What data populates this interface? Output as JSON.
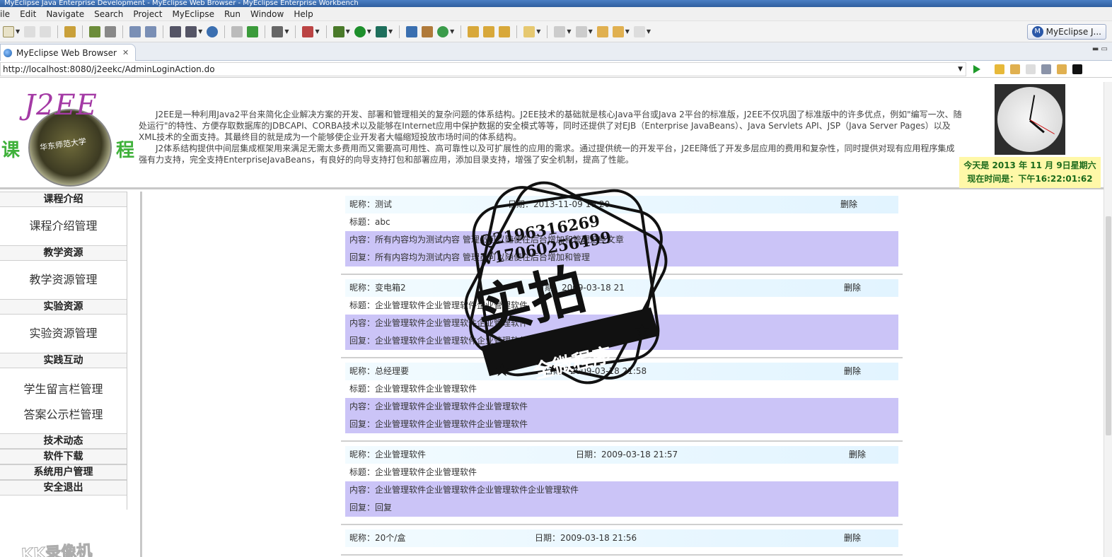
{
  "window": {
    "title": "MyEclipse Java Enterprise Development - MyEclipse Web Browser - MyEclipse Enterprise Workbench"
  },
  "menu": [
    "ile",
    "Edit",
    "Navigate",
    "Search",
    "Project",
    "MyEclipse",
    "Run",
    "Window",
    "Help"
  ],
  "perspective": {
    "label": "MyEclipse J..."
  },
  "tab": {
    "label": "MyEclipse Web Browser",
    "close": "✕"
  },
  "address": {
    "url": "http://localhost:8080/j2eekc/AdminLoginAction.do"
  },
  "header": {
    "logo_text": "J2EE",
    "logo_left": "课",
    "logo_right": "程",
    "seal_text": "华东师范大学",
    "intro_p1": "J2EE是一种利用Java2平台来简化企业解决方案的开发、部署和管理相关的复杂问题的体系结构。J2EE技术的基础就是核心Java平台或Java 2平台的标准版，J2EE不仅巩固了标准版中的许多优点，例如\"编写一次、随处运行\"的特性、方便存取数据库的JDBCAPI、CORBA技术以及能够在Internet应用中保护数据的安全模式等等，同时还提供了对EJB（Enterprise JavaBeans）、Java Servlets API、JSP（Java Server Pages）以及XML技术的全面支持。其最终目的就是成为一个能够使企业开发者大幅缩短投放市场时间的体系结构。",
    "intro_p2": "J2体系结构提供中间层集成框架用来满足无需太多费用而又需要高可用性、高可靠性以及可扩展性的应用的需求。通过提供统一的开发平台，J2EE降低了开发多层应用的费用和复杂性，同时提供对现有应用程序集成强有力支持，完全支持EnterpriseJavaBeans，有良好的向导支持打包和部署应用，添加目录支持，增强了安全机制，提高了性能。",
    "today": "今天是 2013 年 11 月 9日星期六",
    "now": "现在时间是：下午16:22:01:62"
  },
  "sidebar": {
    "sections": [
      {
        "title": "课程介绍",
        "items": [
          "课程介绍管理"
        ]
      },
      {
        "title": "教学资源",
        "items": [
          "教学资源管理"
        ]
      },
      {
        "title": "实验资源",
        "items": [
          "实验资源管理"
        ]
      },
      {
        "title": "实践互动",
        "items": [
          "学生留言栏管理",
          "答案公示栏管理"
        ]
      },
      {
        "title": "技术动态",
        "items": []
      },
      {
        "title": "软件下载",
        "items": []
      },
      {
        "title": "系统用户管理",
        "items": []
      },
      {
        "title": "安全退出",
        "items": []
      }
    ]
  },
  "labels": {
    "nick": "昵称：",
    "date": "日期：",
    "title": "标题：",
    "content": "内容：",
    "reply": "回复：",
    "delete": "删除"
  },
  "messages": [
    {
      "nick": "测试",
      "date": "2013-11-09 16:20",
      "title": "abc",
      "content": "所有内容均为测试内容  管理员可以随便在后台增加和管理这些文章",
      "reply": "所有内容均为测试内容  管理员可以随便在后台增加和管理"
    },
    {
      "nick": "变电箱2",
      "date": "2009-03-18 21",
      "title": "企业管理软件企业管理软件企业管理软件",
      "content": "企业管理软件企业管理软件企业管理软件",
      "reply": "企业管理软件企业管理软件企业管理软件"
    },
    {
      "nick": "总经理要",
      "date": "2009-03-18 21:58",
      "title": "企业管理软件企业管理软件",
      "content": "企业管理软件企业管理软件企业管理软件",
      "reply": "企业管理软件企业管理软件企业管理软件"
    },
    {
      "nick": "企业管理软件",
      "date": "2009-03-18 21:57",
      "title": "企业管理软件企业管理软件",
      "content": "企业管理软件企业管理软件企业管理软件企业管理软件",
      "reply": "回复"
    },
    {
      "nick": "20个/盒",
      "date": "2009-03-18 21:56",
      "title": "",
      "content": "",
      "reply": ""
    }
  ],
  "stamp": {
    "line1": "Q2196316269",
    "line2": "V17060256499",
    "big": "实拍",
    "ribbon": "全微程序"
  },
  "watermark": "KK录像机"
}
